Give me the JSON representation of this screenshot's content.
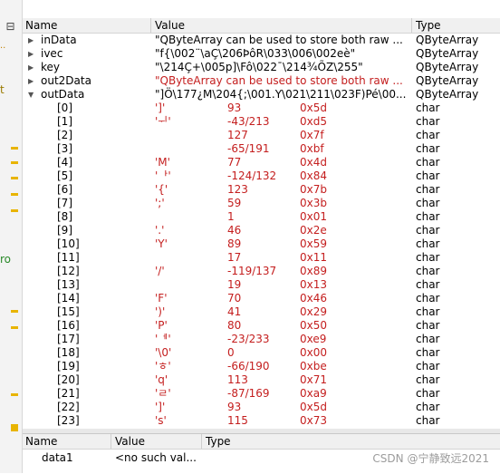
{
  "gutter": {
    "collapse_glyph": "⊟",
    "dots": "··",
    "t_text": "t",
    "ro_text": "ro"
  },
  "tree": {
    "headers": {
      "name": "Name",
      "value": "Value",
      "type": "Type"
    },
    "top_rows": [
      {
        "name": "inData",
        "value": "\"QByteArray can be used to store both raw ...",
        "type": "QByteArray",
        "value_color": "#000000",
        "expanded": false
      },
      {
        "name": "ivec",
        "value": "\"f{\\002¨\\aÇ\\206ÞôR\\033\\006\\002eè\"",
        "type": "QByteArray",
        "value_color": "#000000",
        "expanded": false
      },
      {
        "name": "key",
        "value": "\"\\214Ç+\\005p]\\Fô\\022¯\\214¾ÕZ\\255\"",
        "type": "QByteArray",
        "value_color": "#000000",
        "expanded": false
      },
      {
        "name": "out2Data",
        "value": "\"QByteArray can be used to store both raw ...",
        "type": "QByteArray",
        "value_color": "#c41e1e",
        "expanded": false
      },
      {
        "name": "outData",
        "value": "\"]Ö\\177¿M\\204{;\\001.Y\\021\\211\\023F)Pé\\00...",
        "type": "QByteArray",
        "value_color": "#000000",
        "expanded": true
      }
    ],
    "children": [
      {
        "index": "[0]",
        "char": "']'",
        "dec": "93",
        "hex": "0x5d",
        "type": "char"
      },
      {
        "index": "[1]",
        "char": "'ᅱ'",
        "dec": "-43/213",
        "hex": "0xd5",
        "type": "char"
      },
      {
        "index": "[2]",
        "char": "",
        "dec": "127",
        "hex": "0x7f",
        "type": "char"
      },
      {
        "index": "[3]",
        "char": "",
        "dec": "-65/191",
        "hex": "0xbf",
        "type": "char"
      },
      {
        "index": "[4]",
        "char": "'M'",
        "dec": "77",
        "hex": "0x4d",
        "type": "char"
      },
      {
        "index": "[5]",
        "char": "'ᅡ'",
        "dec": "-124/132",
        "hex": "0x84",
        "type": "char"
      },
      {
        "index": "[6]",
        "char": "'{'",
        "dec": "123",
        "hex": "0x7b",
        "type": "char"
      },
      {
        "index": "[7]",
        "char": "';'",
        "dec": "59",
        "hex": "0x3b",
        "type": "char"
      },
      {
        "index": "[8]",
        "char": "",
        "dec": "1",
        "hex": "0x01",
        "type": "char"
      },
      {
        "index": "[9]",
        "char": "'.'",
        "dec": "46",
        "hex": "0x2e",
        "type": "char"
      },
      {
        "index": "[10]",
        "char": "'Y'",
        "dec": "89",
        "hex": "0x59",
        "type": "char"
      },
      {
        "index": "[11]",
        "char": "",
        "dec": "17",
        "hex": "0x11",
        "type": "char"
      },
      {
        "index": "[12]",
        "char": "'/'",
        "dec": "-119/137",
        "hex": "0x89",
        "type": "char"
      },
      {
        "index": "[13]",
        "char": "",
        "dec": "19",
        "hex": "0x13",
        "type": "char"
      },
      {
        "index": "[14]",
        "char": "'F'",
        "dec": "70",
        "hex": "0x46",
        "type": "char"
      },
      {
        "index": "[15]",
        "char": "')'",
        "dec": "41",
        "hex": "0x29",
        "type": "char"
      },
      {
        "index": "[16]",
        "char": "'P'",
        "dec": "80",
        "hex": "0x50",
        "type": "char"
      },
      {
        "index": "[17]",
        "char": "'ᅦ'",
        "dec": "-23/233",
        "hex": "0xe9",
        "type": "char"
      },
      {
        "index": "[18]",
        "char": "'\\0'",
        "dec": "0",
        "hex": "0x00",
        "type": "char"
      },
      {
        "index": "[19]",
        "char": "'ㅎ'",
        "dec": "-66/190",
        "hex": "0xbe",
        "type": "char"
      },
      {
        "index": "[20]",
        "char": "'q'",
        "dec": "113",
        "hex": "0x71",
        "type": "char"
      },
      {
        "index": "[21]",
        "char": "'ㄹ'",
        "dec": "-87/169",
        "hex": "0xa9",
        "type": "char"
      },
      {
        "index": "[22]",
        "char": "']'",
        "dec": "93",
        "hex": "0x5d",
        "type": "char"
      },
      {
        "index": "[23]",
        "char": "'s'",
        "dec": "115",
        "hex": "0x73",
        "type": "char"
      }
    ]
  },
  "watch": {
    "headers": {
      "name": "Name",
      "value": "Value",
      "type": "Type"
    },
    "rows": [
      {
        "name": "data1",
        "value": "<no such val...",
        "type": ""
      }
    ]
  },
  "watermark": "CSDN @宁静致远2021",
  "colors": {
    "changed_value": "#c41e1e",
    "marker": "#e8b400",
    "header_bg": "#f0f0f0"
  }
}
